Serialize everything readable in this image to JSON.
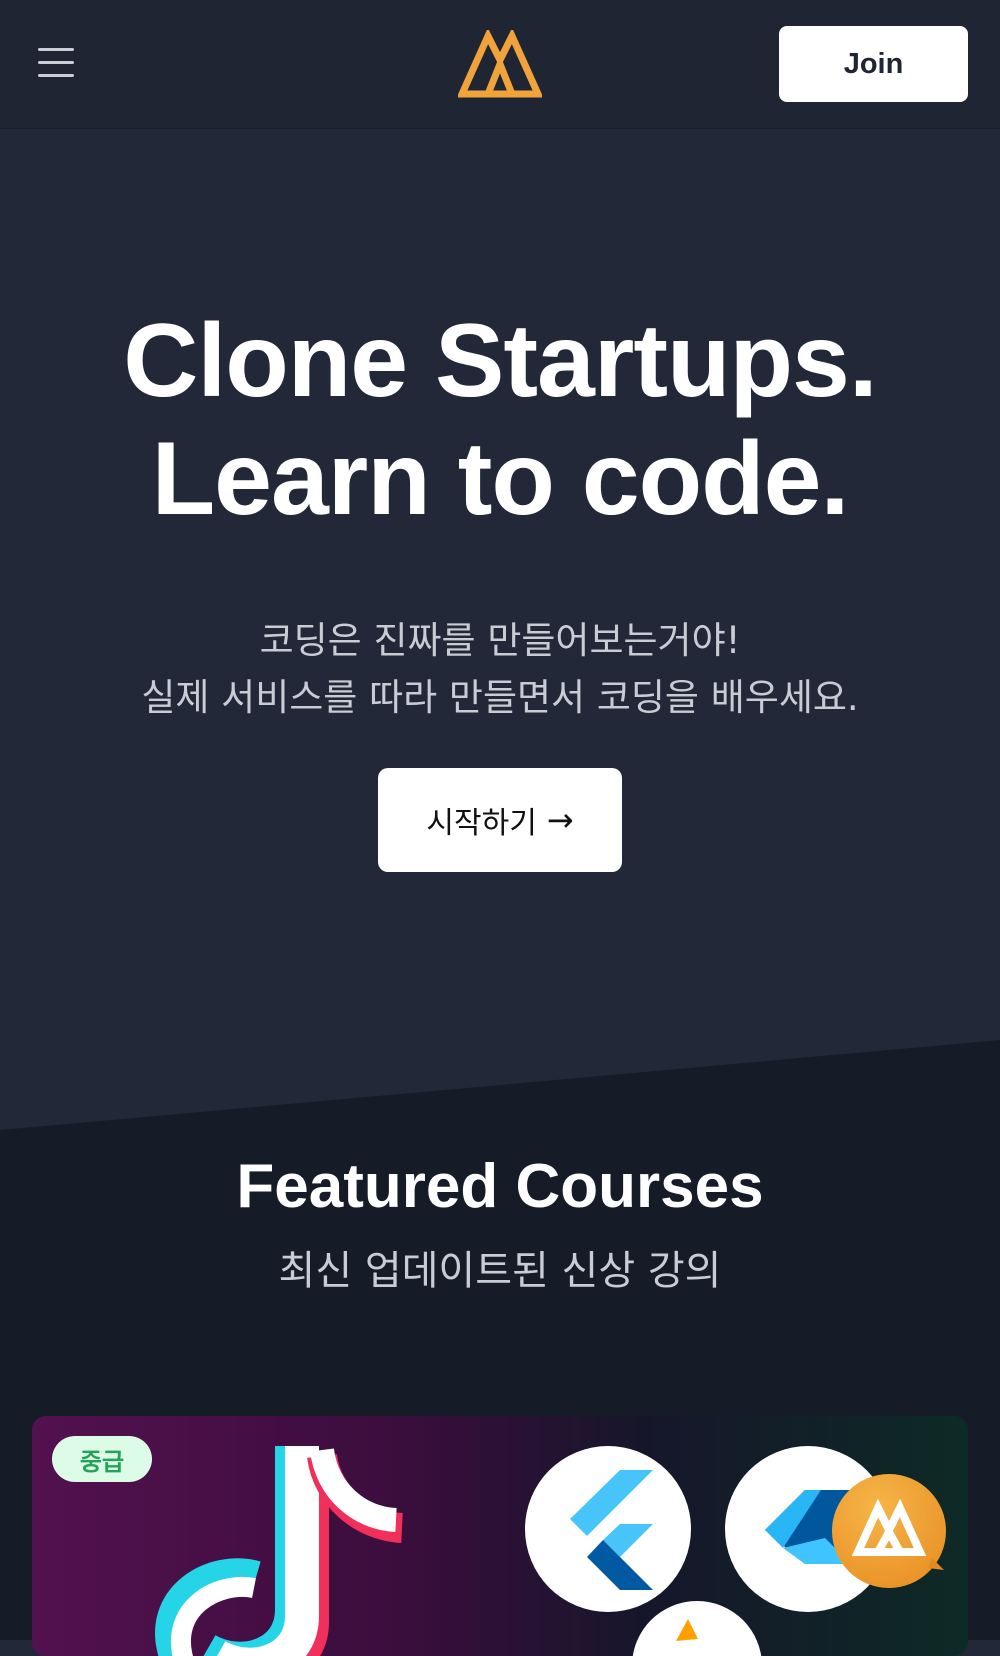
{
  "header": {
    "menu_icon": "hamburger-menu-icon",
    "logo_icon": "nomad-logo-icon",
    "join_label": "Join"
  },
  "hero": {
    "title_line1": "Clone Startups.",
    "title_line2": "Learn to code.",
    "subtitle_line1": "코딩은 진짜를 만들어보는거야!",
    "subtitle_line2": "실제 서비스를 따라 만들면서 코딩을 배우세요.",
    "start_label": "시작하기",
    "start_arrow": "→"
  },
  "featured": {
    "title": "Featured Courses",
    "subtitle": "최신 업데이트된 신상 강의"
  },
  "course": {
    "level_badge": "중급",
    "icons": [
      "tiktok-logo-icon",
      "flutter-logo-icon",
      "dart-logo-icon",
      "firebase-logo-icon",
      "nomad-badge-icon"
    ]
  },
  "colors": {
    "brand_orange": "#f0a33a",
    "background": "#222838",
    "dark_band": "#161b28",
    "badge_green": "#22a35a"
  }
}
